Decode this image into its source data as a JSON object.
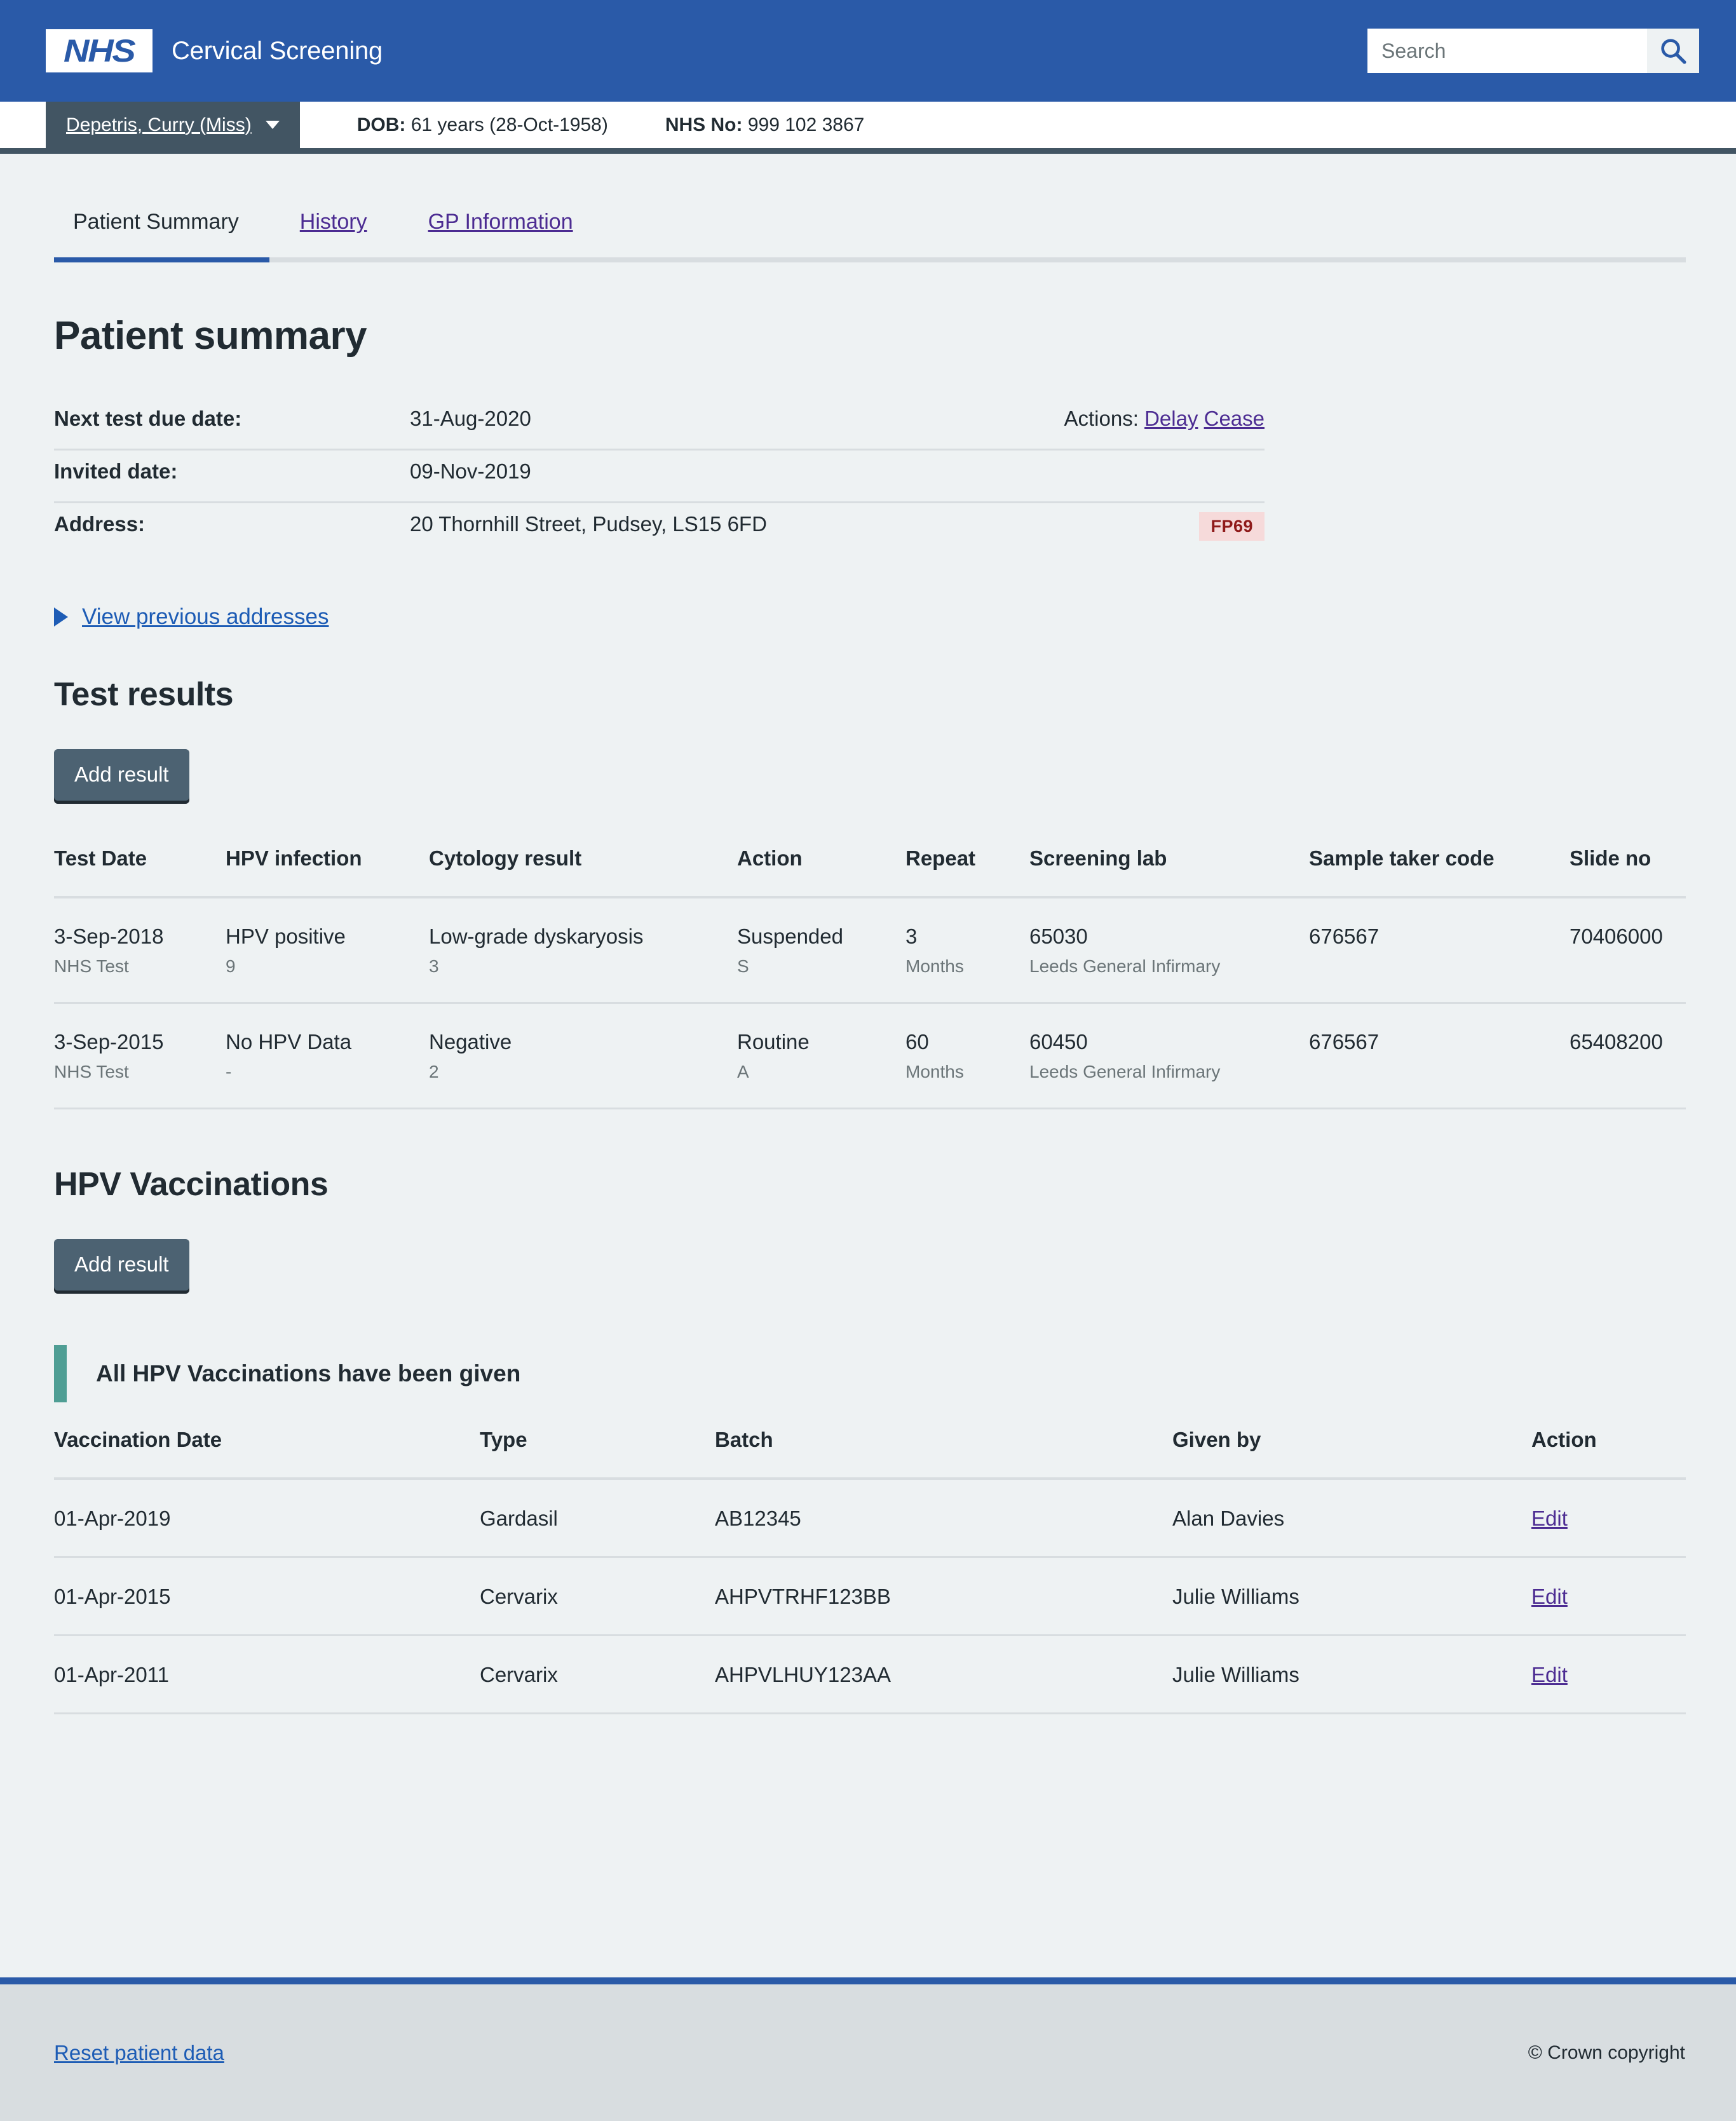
{
  "header": {
    "logo_text": "NHS",
    "logo_icon": "nhs-logo",
    "service_name": "Cervical Screening",
    "search": {
      "placeholder": "Search",
      "value": "",
      "button_icon": "search-icon"
    }
  },
  "patient_bar": {
    "name": "Depetris, Curry (Miss)",
    "caret_icon": "chevron-down-icon",
    "dob_label": "DOB:",
    "dob_value": "61 years (28-Oct-1958)",
    "nhs_no_label": "NHS No:",
    "nhs_no_value": "999 102 3867"
  },
  "tabs": [
    {
      "label": "Patient Summary",
      "active": true
    },
    {
      "label": "History",
      "active": false
    },
    {
      "label": "GP Information",
      "active": false
    }
  ],
  "patient_summary": {
    "title": "Patient summary",
    "rows": [
      {
        "key": "Next test due date:",
        "value": "31-Aug-2020",
        "actions_label": "Actions:",
        "actions": [
          "Delay",
          "Cease"
        ]
      },
      {
        "key": "Invited date:",
        "value": "09-Nov-2019",
        "actions_label": "",
        "actions": []
      },
      {
        "key": "Address:",
        "value": "20 Thornhill Street, Pudsey, LS15 6FD",
        "tag": "FP69"
      }
    ],
    "previous_addresses_link": "View previous addresses",
    "disclosure_icon": "triangle-right-icon"
  },
  "test_results": {
    "title": "Test results",
    "add_button": "Add result",
    "columns": [
      "Test Date",
      "HPV infection",
      "Cytology result",
      "Action",
      "Repeat",
      "Screening lab",
      "Sample taker code",
      "Slide no"
    ],
    "rows": [
      {
        "test_date": "3-Sep-2018",
        "test_date_sub": "NHS Test",
        "hpv": "HPV positive",
        "hpv_sub": "9",
        "cytology": "Low-grade dyskaryosis",
        "cytology_sub": "3",
        "action": "Suspended",
        "action_sub": "S",
        "repeat": "3",
        "repeat_sub": "Months",
        "lab": "65030",
        "lab_sub": "Leeds General Infirmary",
        "taker_code": "676567",
        "taker_code_sub": "",
        "slide_no": "70406000",
        "slide_no_sub": ""
      },
      {
        "test_date": "3-Sep-2015",
        "test_date_sub": "NHS Test",
        "hpv": "No HPV Data",
        "hpv_sub": "-",
        "cytology": "Negative",
        "cytology_sub": "2",
        "action": "Routine",
        "action_sub": "A",
        "repeat": "60",
        "repeat_sub": "Months",
        "lab": "60450",
        "lab_sub": "Leeds General Infirmary",
        "taker_code": "676567",
        "taker_code_sub": "",
        "slide_no": "65408200",
        "slide_no_sub": ""
      }
    ]
  },
  "hpv_vaccinations": {
    "title": "HPV Vaccinations",
    "add_button": "Add result",
    "banner": "All HPV Vaccinations have been given",
    "columns": [
      "Vaccination Date",
      "Type",
      "Batch",
      "Given by",
      "Action"
    ],
    "rows": [
      {
        "date": "01-Apr-2019",
        "type": "Gardasil",
        "batch": "AB12345",
        "given_by": "Alan Davies",
        "action": "Edit"
      },
      {
        "date": "01-Apr-2015",
        "type": "Cervarix",
        "batch": "AHPVTRHF123BB",
        "given_by": "Julie Williams",
        "action": "Edit"
      },
      {
        "date": "01-Apr-2011",
        "type": "Cervarix",
        "batch": "AHPVLHUY123AA",
        "given_by": "Julie Williams",
        "action": "Edit"
      }
    ]
  },
  "footer": {
    "reset_link": "Reset patient data",
    "copyright": "© Crown copyright"
  },
  "colors": {
    "nhs_blue": "#2a5aa8",
    "dark_slate": "#425563",
    "button_grey": "#4c6272",
    "link_blue": "#1d5cb5",
    "link_visited": "#4c2c92",
    "page_bg": "#eef2f3",
    "footer_bg": "#d8dde0",
    "banner_green": "#4f9e94",
    "tag_bg": "#f6dada",
    "tag_text": "#8f1a1a"
  }
}
